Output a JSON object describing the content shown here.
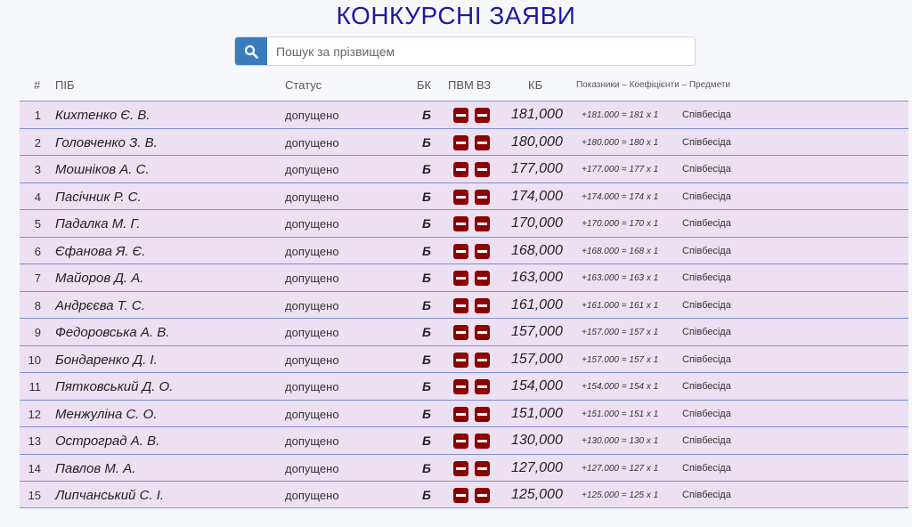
{
  "page": {
    "title": "КОНКУРСНІ ЗАЯВИ"
  },
  "search": {
    "placeholder": "Пошук за прізвищем",
    "icon": "search-icon"
  },
  "table": {
    "headers": {
      "num": "#",
      "name": "ПІБ",
      "status": "Статус",
      "bk": "БК",
      "pvm": "ПВМ",
      "vz": "ВЗ",
      "kb": "КБ",
      "details": "Показники – Коефіцієнти – Предмети"
    },
    "rows": [
      {
        "num": "1",
        "name": "Кихтенко Є. В.",
        "status": "допущено",
        "bk": "Б",
        "kb": "181,000",
        "formula": "+181.000 = 181 x 1",
        "subject": "Співбесіда"
      },
      {
        "num": "2",
        "name": "Головченко З. В.",
        "status": "допущено",
        "bk": "Б",
        "kb": "180,000",
        "formula": "+180.000 = 180 x 1",
        "subject": "Співбесіда"
      },
      {
        "num": "3",
        "name": "Мошніков А. С.",
        "status": "допущено",
        "bk": "Б",
        "kb": "177,000",
        "formula": "+177.000 = 177 x 1",
        "subject": "Співбесіда"
      },
      {
        "num": "4",
        "name": "Пасічник Р. С.",
        "status": "допущено",
        "bk": "Б",
        "kb": "174,000",
        "formula": "+174.000 = 174 x 1",
        "subject": "Співбесіда"
      },
      {
        "num": "5",
        "name": "Падалка М. Г.",
        "status": "допущено",
        "bk": "Б",
        "kb": "170,000",
        "formula": "+170.000 = 170 x 1",
        "subject": "Співбесіда"
      },
      {
        "num": "6",
        "name": "Єфанова Я. Є.",
        "status": "допущено",
        "bk": "Б",
        "kb": "168,000",
        "formula": "+168.000 = 168 x 1",
        "subject": "Співбесіда"
      },
      {
        "num": "7",
        "name": "Майоров Д. А.",
        "status": "допущено",
        "bk": "Б",
        "kb": "163,000",
        "formula": "+163.000 = 163 x 1",
        "subject": "Співбесіда"
      },
      {
        "num": "8",
        "name": "Андрєєва Т. С.",
        "status": "допущено",
        "bk": "Б",
        "kb": "161,000",
        "formula": "+161.000 = 161 x 1",
        "subject": "Співбесіда"
      },
      {
        "num": "9",
        "name": "Федоровська А. В.",
        "status": "допущено",
        "bk": "Б",
        "kb": "157,000",
        "formula": "+157.000 = 157 x 1",
        "subject": "Співбесіда"
      },
      {
        "num": "10",
        "name": "Бондаренко Д. І.",
        "status": "допущено",
        "bk": "Б",
        "kb": "157,000",
        "formula": "+157.000 = 157 x 1",
        "subject": "Співбесіда"
      },
      {
        "num": "11",
        "name": "Пятковський Д. О.",
        "status": "допущено",
        "bk": "Б",
        "kb": "154,000",
        "formula": "+154.000 = 154 x 1",
        "subject": "Співбесіда"
      },
      {
        "num": "12",
        "name": "Менжуліна С. О.",
        "status": "допущено",
        "bk": "Б",
        "kb": "151,000",
        "formula": "+151.000 = 151 x 1",
        "subject": "Співбесіда"
      },
      {
        "num": "13",
        "name": "Остроград А. В.",
        "status": "допущено",
        "bk": "Б",
        "kb": "130,000",
        "formula": "+130.000 = 130 x 1",
        "subject": "Співбесіда"
      },
      {
        "num": "14",
        "name": "Павлов М. А.",
        "status": "допущено",
        "bk": "Б",
        "kb": "127,000",
        "formula": "+127.000 = 127 x 1",
        "subject": "Співбесіда"
      },
      {
        "num": "15",
        "name": "Липчанський С. І.",
        "status": "допущено",
        "bk": "Б",
        "kb": "125,000",
        "formula": "+125.000 = 125 x 1",
        "subject": "Співбесіда"
      }
    ]
  },
  "colors": {
    "title": "#1a1aa6",
    "row_background": "#ede0f2",
    "row_border": "#7e8fd0",
    "badge": "#8b0000",
    "search_button": "#3a7dbd"
  }
}
